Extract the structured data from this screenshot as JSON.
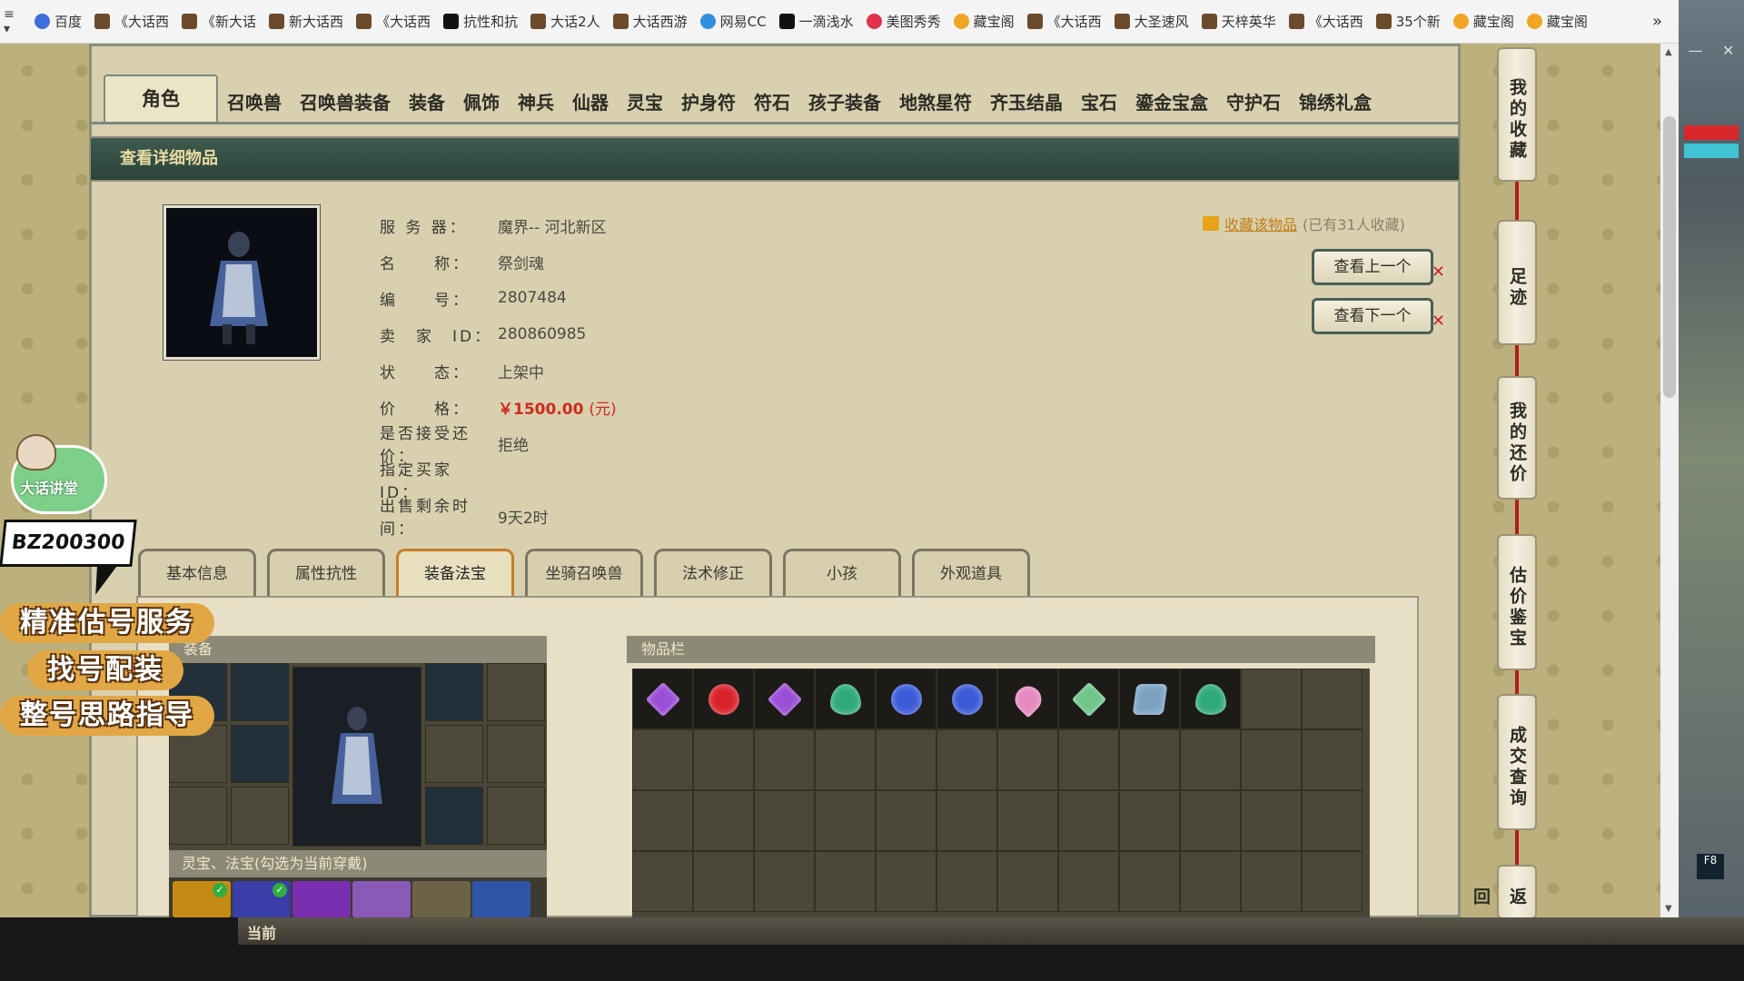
{
  "bookmarks": [
    {
      "label": "百度",
      "icon": "paw-icon"
    },
    {
      "label": "《大话西",
      "icon": "game-icon"
    },
    {
      "label": "《新大话",
      "icon": "game-icon"
    },
    {
      "label": "新大话西",
      "icon": "game-icon"
    },
    {
      "label": "《大话西",
      "icon": "game-icon"
    },
    {
      "label": "抗性和抗",
      "icon": "page-icon"
    },
    {
      "label": "大话2人",
      "icon": "game-icon"
    },
    {
      "label": "大话西游",
      "icon": "game-icon"
    },
    {
      "label": "网易CC",
      "icon": "cloud-icon"
    },
    {
      "label": "一滴浅水",
      "icon": "tiktok-icon"
    },
    {
      "label": "美图秀秀",
      "icon": "meitu-icon"
    },
    {
      "label": "藏宝阁",
      "icon": "star-icon"
    },
    {
      "label": "《大话西",
      "icon": "game-icon"
    },
    {
      "label": "大圣速风",
      "icon": "game-icon"
    },
    {
      "label": "天梓英华",
      "icon": "game-icon"
    },
    {
      "label": "《大话西",
      "icon": "game-icon"
    },
    {
      "label": "35个新",
      "icon": "game-icon"
    },
    {
      "label": "藏宝阁",
      "icon": "star-icon"
    },
    {
      "label": "藏宝阁",
      "icon": "star-icon"
    }
  ],
  "bookmark_more": "»",
  "category_tabs": [
    "角色",
    "召唤兽",
    "召唤兽装备",
    "装备",
    "佩饰",
    "神兵",
    "仙器",
    "灵宝",
    "护身符",
    "符石",
    "孩子装备",
    "地煞星符",
    "齐玉结晶",
    "宝石",
    "鎏金宝盒",
    "守护石",
    "锦绣礼盒"
  ],
  "section_title": "查看详细物品",
  "info": {
    "server_label": "服 务 器：",
    "server": "魔界-- 河北新区",
    "name_label": "名　　称：",
    "name": "祭剑魂",
    "id_label": "编　　号：",
    "id": "2807484",
    "seller_label": "卖　家　ID：",
    "seller_id": "280860985",
    "status_label": "状　　态：",
    "status": "上架中",
    "price_label": "价　　格：",
    "price": "￥1500.00",
    "price_unit": "(元)",
    "bargain_label": "是否接受还价：",
    "bargain": "拒绝",
    "buyer_label": "指定买家 ID：",
    "buyer": "",
    "time_label": "出售剩余时间：",
    "time_left": "9天2时"
  },
  "favorite": {
    "link": "收藏该物品",
    "count": "(已有31人收藏)"
  },
  "nav": {
    "prev": "查看上一个",
    "next": "查看下一个",
    "close": "✕"
  },
  "sub_tabs": [
    "基本信息",
    "属性抗性",
    "装备法宝",
    "坐骑召唤兽",
    "法术修正",
    "小孩",
    "外观道具"
  ],
  "active_sub_tab": "装备法宝",
  "equip_title": "装备",
  "lingbao_title": "灵宝、法宝(勾选为当前穿戴)",
  "inventory_title": "物品栏",
  "inventory_items": [
    {
      "shape": "diamond",
      "color": "#9b4fd6"
    },
    {
      "shape": "round",
      "color": "#d8222a"
    },
    {
      "shape": "diamond",
      "color": "#9b4fd6"
    },
    {
      "shape": "drop",
      "color": "#2fa97a"
    },
    {
      "shape": "round",
      "color": "#3b5bd8"
    },
    {
      "shape": "round",
      "color": "#3b5bd8"
    },
    {
      "shape": "heart",
      "color": "#e58ac0"
    },
    {
      "shape": "diamond",
      "color": "#6fc58a"
    },
    {
      "shape": "cube",
      "color": "#7ca2c2"
    },
    {
      "shape": "drop",
      "color": "#2fa97a"
    }
  ],
  "side_menu": [
    "我的收藏",
    "足迹",
    "我的还价",
    "估价鉴宝",
    "成交查询",
    "返回"
  ],
  "overlay": {
    "mascot": "大话讲堂",
    "badge": "BZ200300",
    "promo1": "精准估号服务",
    "promo2": "找号配装",
    "promo3": "整号思路指导"
  },
  "bottom": {
    "current": "当前"
  },
  "window": {
    "f8": "F8"
  }
}
